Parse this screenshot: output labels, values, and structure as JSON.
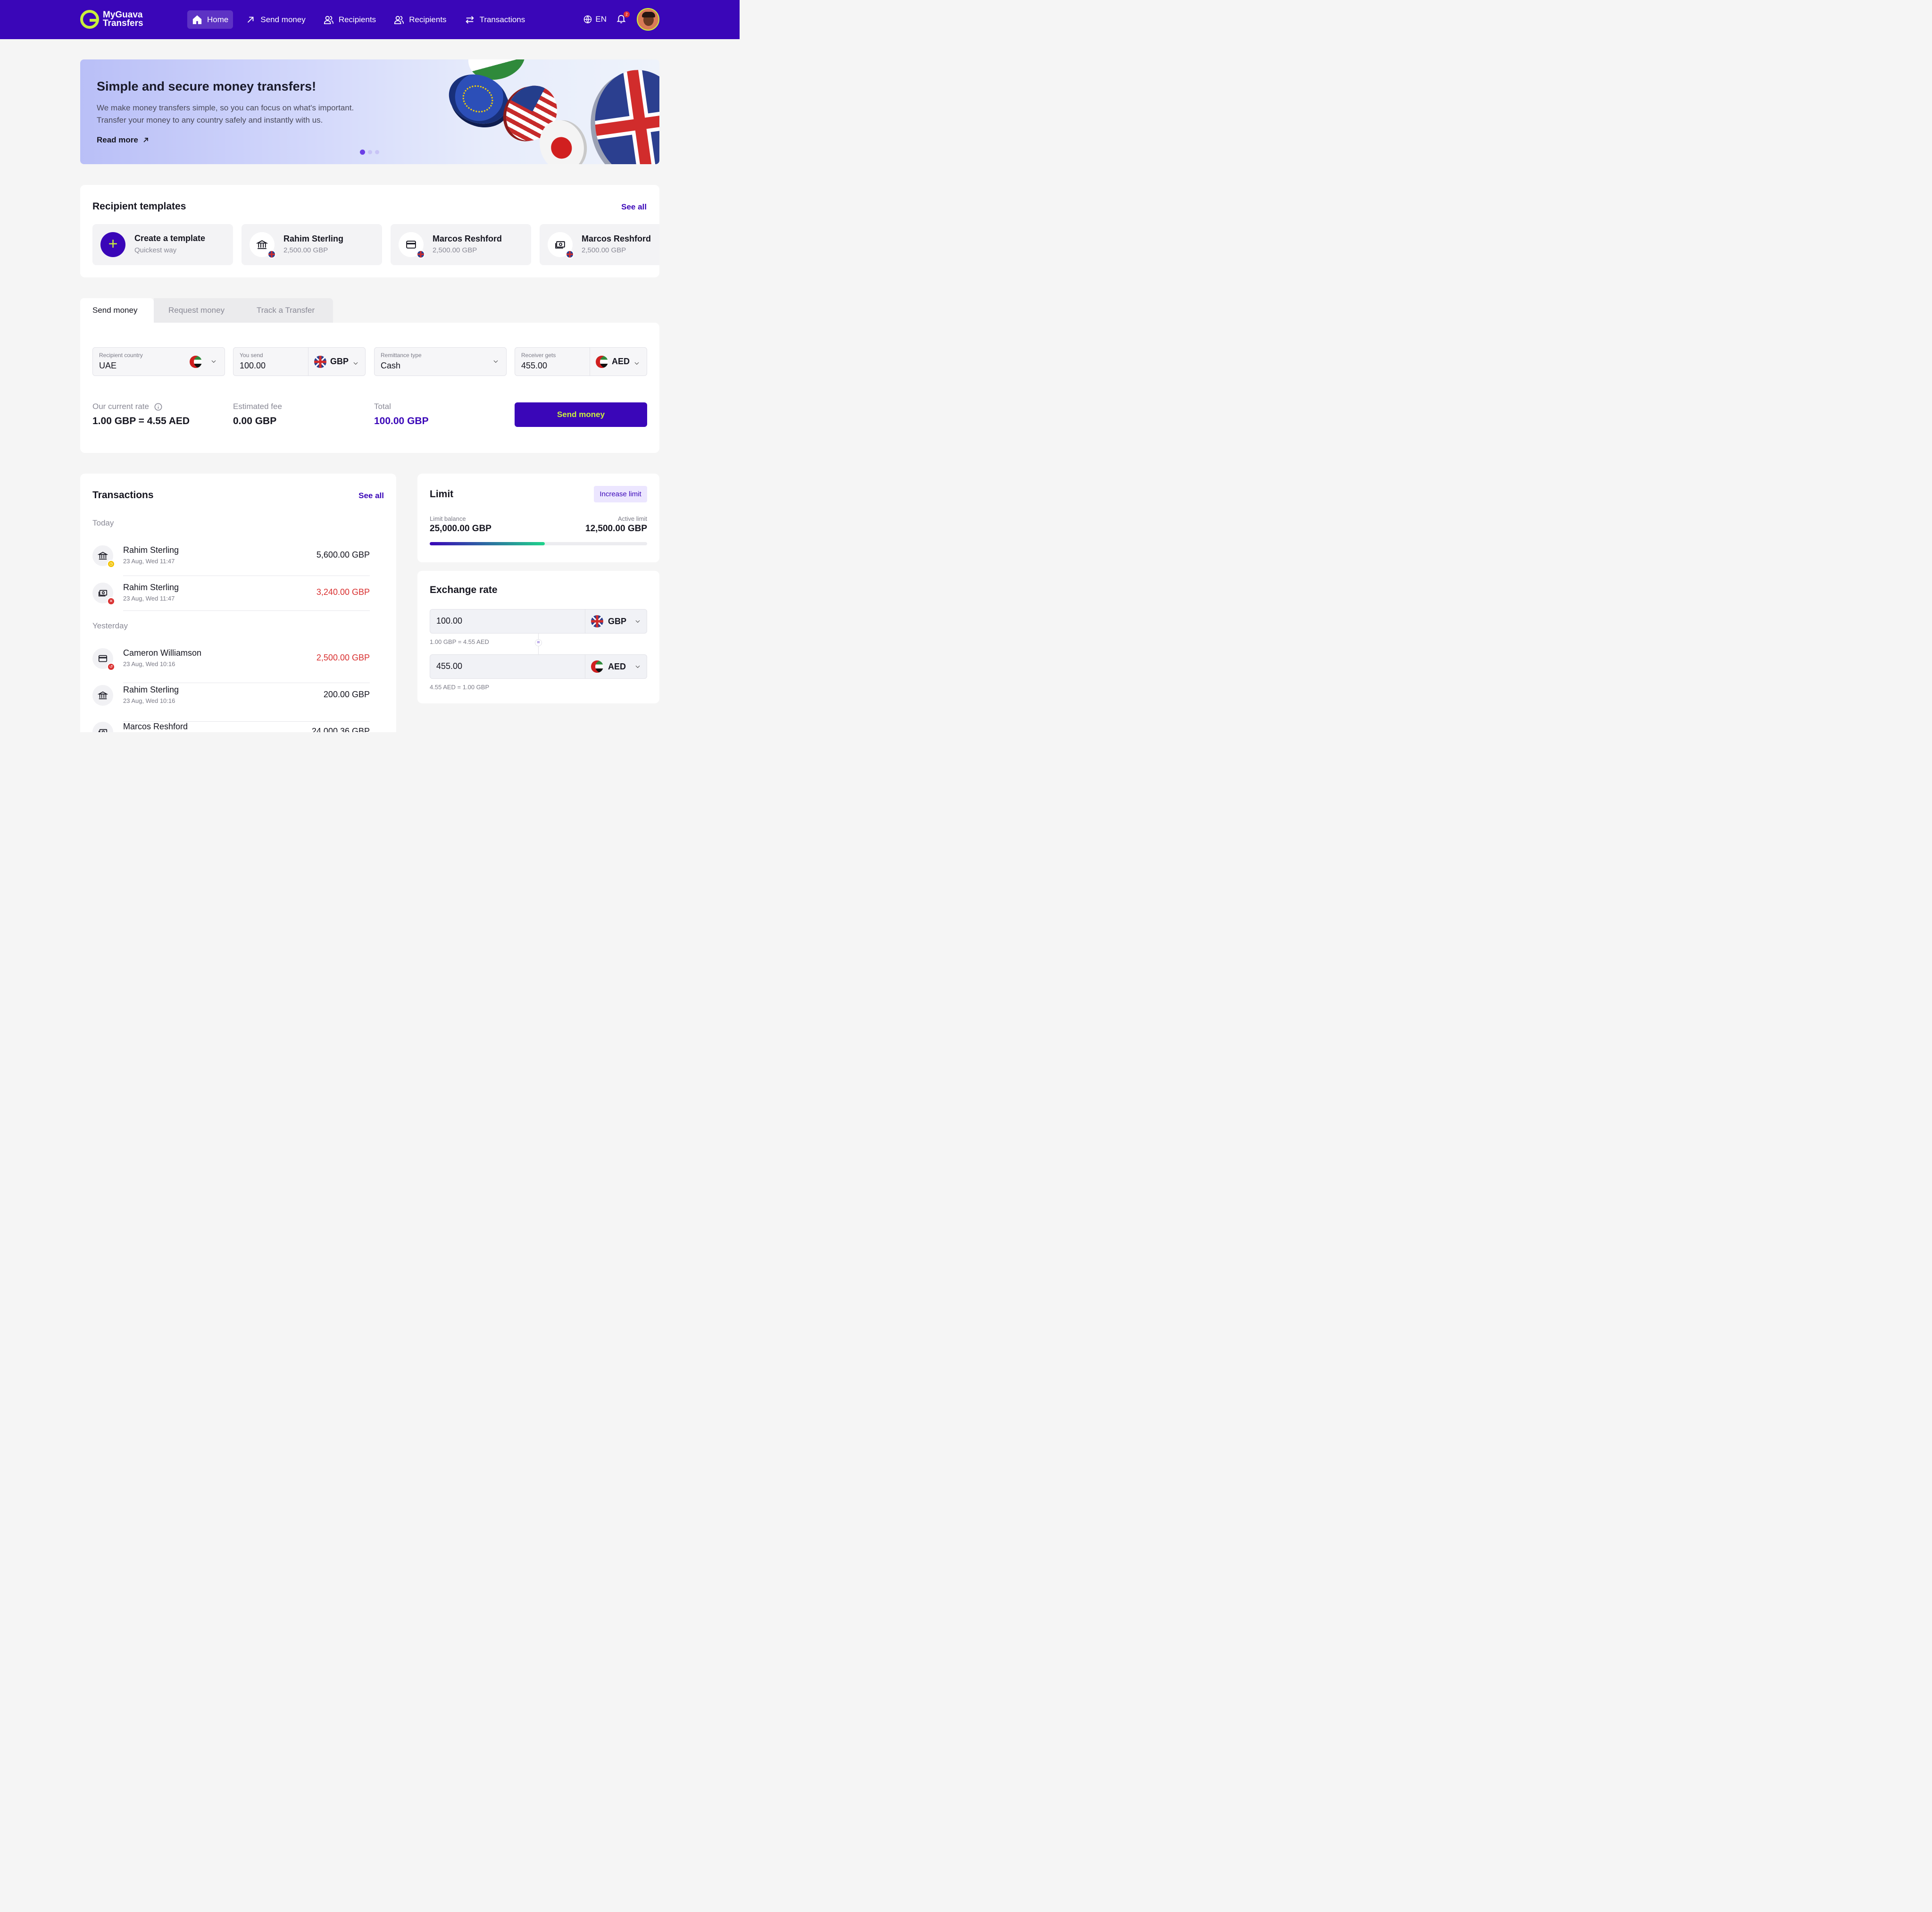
{
  "header": {
    "logo_line1": "MyGuava",
    "logo_line2": "Transfers",
    "nav": [
      {
        "label": "Home"
      },
      {
        "label": "Send money"
      },
      {
        "label": "Recipients"
      },
      {
        "label": "Recipients"
      },
      {
        "label": "Transactions"
      }
    ],
    "language": "EN",
    "notification_count": "2"
  },
  "hero": {
    "title": "Simple and secure money transfers!",
    "text_line1": "We make money transfers simple, so you can focus on what's important.",
    "text_line2": "Transfer your money to any country safely and instantly with us.",
    "read_more": "Read more",
    "slide_count": 3,
    "active_slide": 1
  },
  "templates": {
    "title": "Recipient templates",
    "see_all": "See all",
    "create": {
      "title": "Create a template",
      "subtitle": "Quickest way"
    },
    "items": [
      {
        "name": "Rahim Sterling",
        "amount": "2,500.00 GBP",
        "icon": "bank-icon"
      },
      {
        "name": "Marcos Reshford",
        "amount": "2,500.00 GBP",
        "icon": "card-icon"
      },
      {
        "name": "Marcos Reshford",
        "amount": "2,500.00 GBP",
        "icon": "cash-icon"
      }
    ]
  },
  "tabs": [
    {
      "label": "Send money",
      "active": true
    },
    {
      "label": "Request money",
      "active": false
    },
    {
      "label": "Track a Transfer",
      "active": false
    }
  ],
  "form": {
    "recipient_country": {
      "label": "Recipient country",
      "value": "UAE"
    },
    "you_send": {
      "label": "You send",
      "value": "100.00",
      "currency": "GBP"
    },
    "remittance_type": {
      "label": "Remittance type",
      "value": "Cash"
    },
    "receiver_gets": {
      "label": "Receiver gets",
      "value": "455.00",
      "currency": "AED"
    },
    "rate_label": "Our current rate",
    "rate_value": "1.00 GBP = 4.55 AED",
    "fee_label": "Estimated fee",
    "fee_value": "0.00 GBP",
    "total_label": "Total",
    "total_value": "100.00 GBP",
    "submit": "Send money"
  },
  "transactions": {
    "title": "Transactions",
    "see_all": "See all",
    "groups": [
      {
        "day": "Today"
      },
      {
        "day": "Yesterday"
      }
    ],
    "items": [
      {
        "name": "Rahim Sterling",
        "date": "23 Aug, Wed 11:47",
        "amount": "5,600.00 GBP",
        "status": "pending",
        "icon": "bank-icon"
      },
      {
        "name": "Rahim Sterling",
        "date": "23 Aug, Wed 11:47",
        "amount": "3,240.00 GBP",
        "status": "failed",
        "icon": "cash-icon"
      },
      {
        "name": "Cameron Williamson",
        "date": "23 Aug, Wed 10:16",
        "amount": "2,500.00 GBP",
        "status": "returned",
        "icon": "card-icon"
      },
      {
        "name": "Rahim Sterling",
        "date": "23 Aug, Wed 10:16",
        "amount": "200.00 GBP",
        "status": "done",
        "icon": "bank-icon"
      },
      {
        "name": "Marcos Reshford",
        "date": "",
        "amount": "24,000.36 GBP",
        "status": "done",
        "icon": "cash-icon"
      }
    ]
  },
  "limit": {
    "title": "Limit",
    "increase": "Increase limit",
    "balance_label": "Limit balance",
    "balance_value": "25,000.00 GBP",
    "active_label": "Active limit",
    "active_value": "12,500.00 GBP",
    "progress_fraction": 0.53
  },
  "exchange": {
    "title": "Exchange rate",
    "from_value": "100.00",
    "from_currency": "GBP",
    "from_note": "1.00 GBP = 4.55 AED",
    "to_value": "455.00",
    "to_currency": "AED",
    "to_note": "4.55 AED = 1.00 GBP",
    "equals": "="
  },
  "colors": {
    "brand": "#3a06b8",
    "accent": "#c9f03c",
    "negative": "#d93030"
  }
}
